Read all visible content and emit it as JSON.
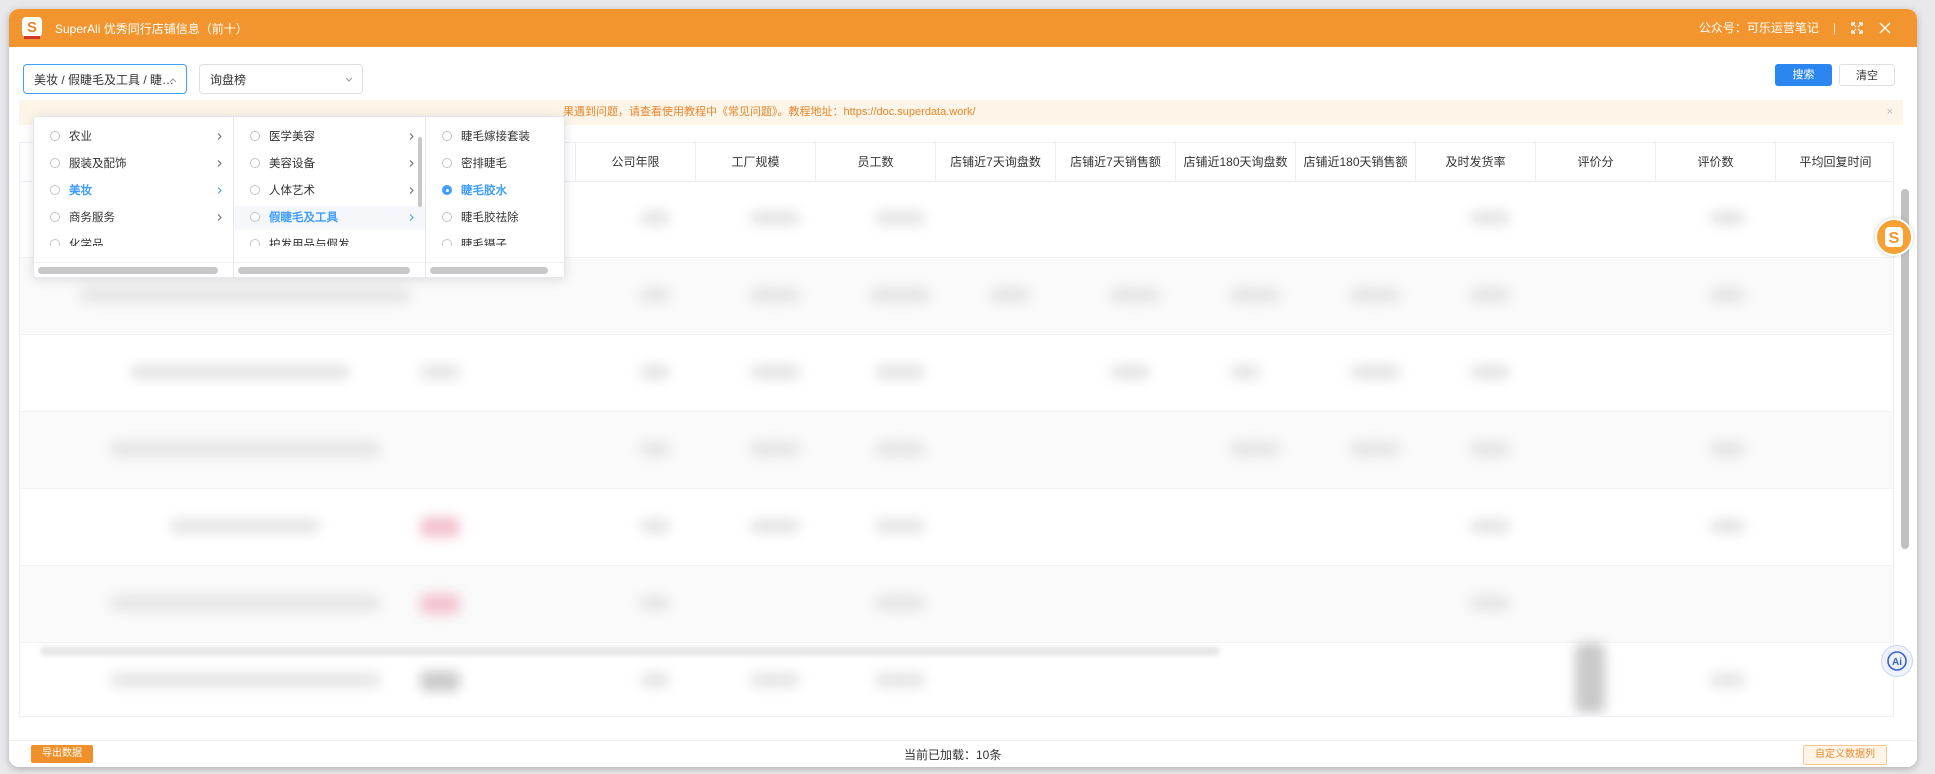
{
  "window": {
    "title": "SuperAli 优秀同行店铺信息（前十）",
    "account": "公众号：可乐运营笔记",
    "separator": "|"
  },
  "filters": {
    "category_value": "美妆 / 假睫毛及工具 / 睫…",
    "rank_value": "询盘榜",
    "search_label": "搜索",
    "clear_label": "清空"
  },
  "notice": {
    "text": "果遇到问题，请查看使用教程中《常见问题》。教程地址：https://doc.superdata.work/",
    "close": "×"
  },
  "table": {
    "columns": [
      "公司年限",
      "工厂规模",
      "员工数",
      "店铺近7天询盘数",
      "店铺近7天销售额",
      "店铺近180天询盘数",
      "店铺近180天销售额",
      "及时发货率",
      "评价分",
      "评价数",
      "平均回复时间"
    ]
  },
  "cascader": {
    "level1": [
      {
        "label": "农业",
        "has_children": true
      },
      {
        "label": "服装及配饰",
        "has_children": true
      },
      {
        "label": "美妆",
        "has_children": true,
        "selected": true
      },
      {
        "label": "商务服务",
        "has_children": true
      },
      {
        "label": "化学品",
        "has_children": true
      }
    ],
    "level2": [
      {
        "label": "医学美容",
        "has_children": true
      },
      {
        "label": "美容设备",
        "has_children": true
      },
      {
        "label": "人体艺术",
        "has_children": true
      },
      {
        "label": "假睫毛及工具",
        "has_children": true,
        "selected": true
      },
      {
        "label": "护发用品与假发",
        "has_children": true
      }
    ],
    "level3": [
      {
        "label": "睫毛嫁接套装"
      },
      {
        "label": "密排睫毛"
      },
      {
        "label": "睫毛胶水",
        "selected": true
      },
      {
        "label": "睫毛胶祛除"
      },
      {
        "label": "睫毛镊子"
      }
    ]
  },
  "footer": {
    "export_label": "导出数据",
    "loaded_text": "当前已加载：10条",
    "custom_label": "自定义数据列"
  },
  "colors": {
    "brand": "#f2952e",
    "primary": "#2c86f0",
    "notice_text": "#e6862a"
  },
  "icons": [
    "app-logo-icon",
    "fullscreen-icon",
    "close-icon",
    "chevron-down-icon",
    "chevron-right-icon",
    "radio-icon",
    "superali-s-icon",
    "ai-assistant-icon"
  ]
}
